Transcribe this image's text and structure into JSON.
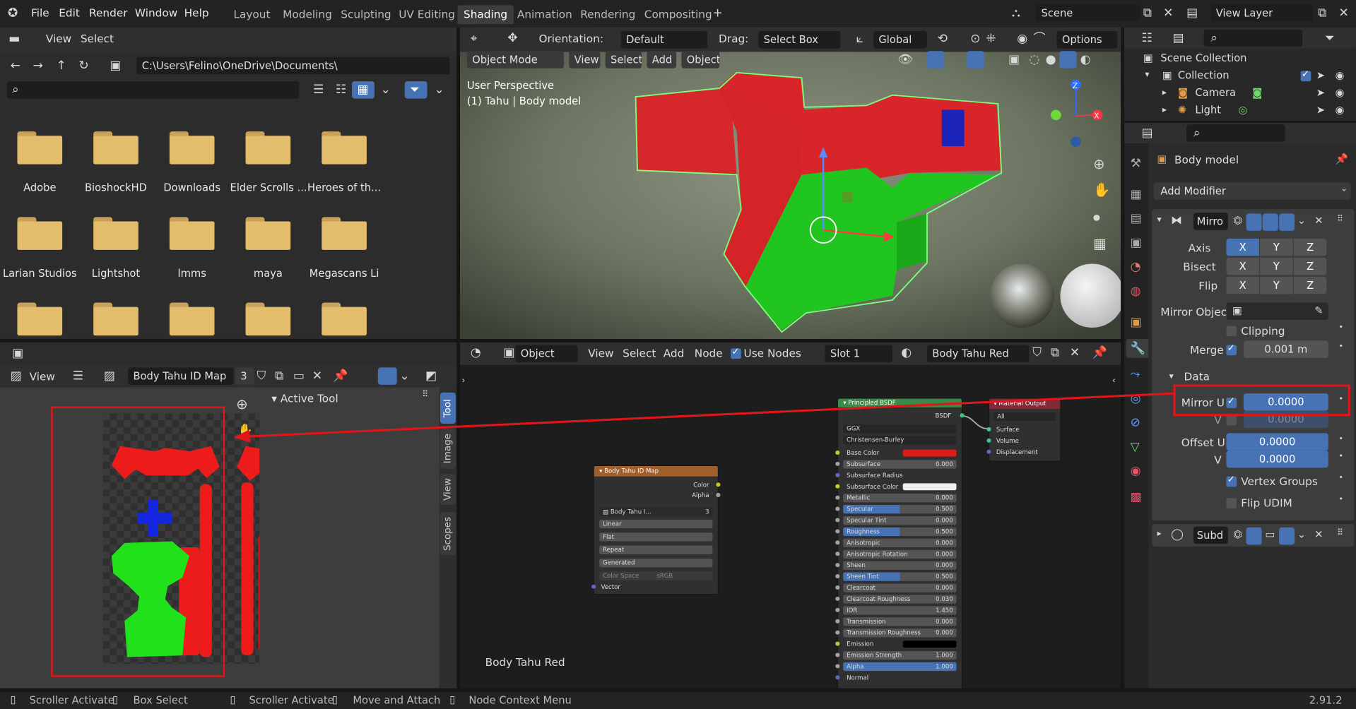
{
  "menu": {
    "file": "File",
    "edit": "Edit",
    "render": "Render",
    "window": "Window",
    "help": "Help"
  },
  "workspaces": [
    "Layout",
    "Modeling",
    "Sculpting",
    "UV Editing",
    "Shading",
    "Animation",
    "Rendering",
    "Compositing"
  ],
  "active_workspace": "Shading",
  "scene": {
    "name": "Scene",
    "view_layer": "View Layer"
  },
  "file_browser": {
    "view": "View",
    "select": "Select",
    "path": "C:\\Users\\Felino\\OneDrive\\Documents\\",
    "folders": [
      "Adobe",
      "BioshockHD",
      "Downloads",
      "Elder Scrolls ...",
      "Heroes of th...",
      "Larian Studios",
      "Lightshot",
      "lmms",
      "maya",
      "Megascans Li"
    ]
  },
  "viewport": {
    "orientation_label": "Orientation:",
    "orientation": "Default",
    "drag_label": "Drag:",
    "drag": "Select Box",
    "transform": "Global",
    "options": "Options",
    "mode": "Object Mode",
    "view": "View",
    "select": "Select",
    "add": "Add",
    "object": "Object",
    "perspective": "User Perspective",
    "object_info": "(1) Tahu | Body model",
    "axis_z": "Z",
    "axis_x": "X"
  },
  "image_editor": {
    "view": "View",
    "image_name": "Body Tahu ID Map",
    "users": "3",
    "active_tool": "Active Tool",
    "tabs": [
      "Tool",
      "Image",
      "View",
      "Scopes"
    ]
  },
  "node_editor": {
    "type": "Object",
    "view": "View",
    "select": "Select",
    "add": "Add",
    "node": "Node",
    "use_nodes": "Use Nodes",
    "slot": "Slot 1",
    "material": "Body Tahu Red",
    "footer_label": "Body Tahu Red"
  },
  "image_node": {
    "title": "Body Tahu ID Map",
    "out_color": "Color",
    "out_alpha": "Alpha",
    "image": "Body Tahu I...",
    "users": "3",
    "interp": "Linear",
    "proj": "Flat",
    "ext": "Repeat",
    "src": "Generated",
    "color_space_label": "Color Space",
    "color_space": "sRGB",
    "vector": "Vector"
  },
  "bsdf_node": {
    "title": "Principled BSDF",
    "out": "BSDF",
    "dist": "GGX",
    "sss": "Christensen-Burley",
    "rows": [
      {
        "label": "Base Color",
        "value": ""
      },
      {
        "label": "Subsurface",
        "value": "0.000"
      },
      {
        "label": "Subsurface Radius",
        "value": ""
      },
      {
        "label": "Subsurface Color",
        "value": ""
      },
      {
        "label": "Metallic",
        "value": "0.000"
      },
      {
        "label": "Specular",
        "value": "0.500"
      },
      {
        "label": "Specular Tint",
        "value": "0.000"
      },
      {
        "label": "Roughness",
        "value": "0.500"
      },
      {
        "label": "Anisotropic",
        "value": "0.000"
      },
      {
        "label": "Anisotropic Rotation",
        "value": "0.000"
      },
      {
        "label": "Sheen",
        "value": "0.000"
      },
      {
        "label": "Sheen Tint",
        "value": "0.500"
      },
      {
        "label": "Clearcoat",
        "value": "0.000"
      },
      {
        "label": "Clearcoat Roughness",
        "value": "0.030"
      },
      {
        "label": "IOR",
        "value": "1.450"
      },
      {
        "label": "Transmission",
        "value": "0.000"
      },
      {
        "label": "Transmission Roughness",
        "value": "0.000"
      },
      {
        "label": "Emission",
        "value": ""
      },
      {
        "label": "Emission Strength",
        "value": "1.000"
      },
      {
        "label": "Alpha",
        "value": "1.000"
      },
      {
        "label": "Normal",
        "value": ""
      }
    ]
  },
  "output_node": {
    "title": "Material Output",
    "target": "All",
    "surface": "Surface",
    "volume": "Volume",
    "displacement": "Displacement"
  },
  "outliner": {
    "scene_collection": "Scene Collection",
    "collection": "Collection",
    "camera": "Camera",
    "light": "Light"
  },
  "properties": {
    "object": "Body model",
    "add_modifier": "Add Modifier",
    "mirror_name": "Mirro",
    "axis": "Axis",
    "bisect": "Bisect",
    "flip": "Flip",
    "x": "X",
    "y": "Y",
    "z": "Z",
    "mirror_object": "Mirror Object",
    "clipping": "Clipping",
    "merge": "Merge",
    "merge_value": "0.001 m",
    "data": "Data",
    "mirror_u": "Mirror U",
    "mirror_u_value": "0.0000",
    "v": "V",
    "v_value": "0.0000",
    "offset_u": "Offset U",
    "offset_u_value": "0.0000",
    "offset_v_value": "0.0000",
    "vertex_groups": "Vertex Groups",
    "flip_udim": "Flip UDIM",
    "subd_name": "Subd"
  },
  "status": {
    "a": "Scroller Activate",
    "b": "Box Select",
    "c": "Scroller Activate",
    "d": "Move and Attach",
    "e": "Node Context Menu",
    "version": "2.91.2"
  },
  "colors": {
    "accent": "#4772b3",
    "annotation": "#e0161b",
    "mesh_red": "#e5232a",
    "mesh_green": "#21c51f"
  }
}
